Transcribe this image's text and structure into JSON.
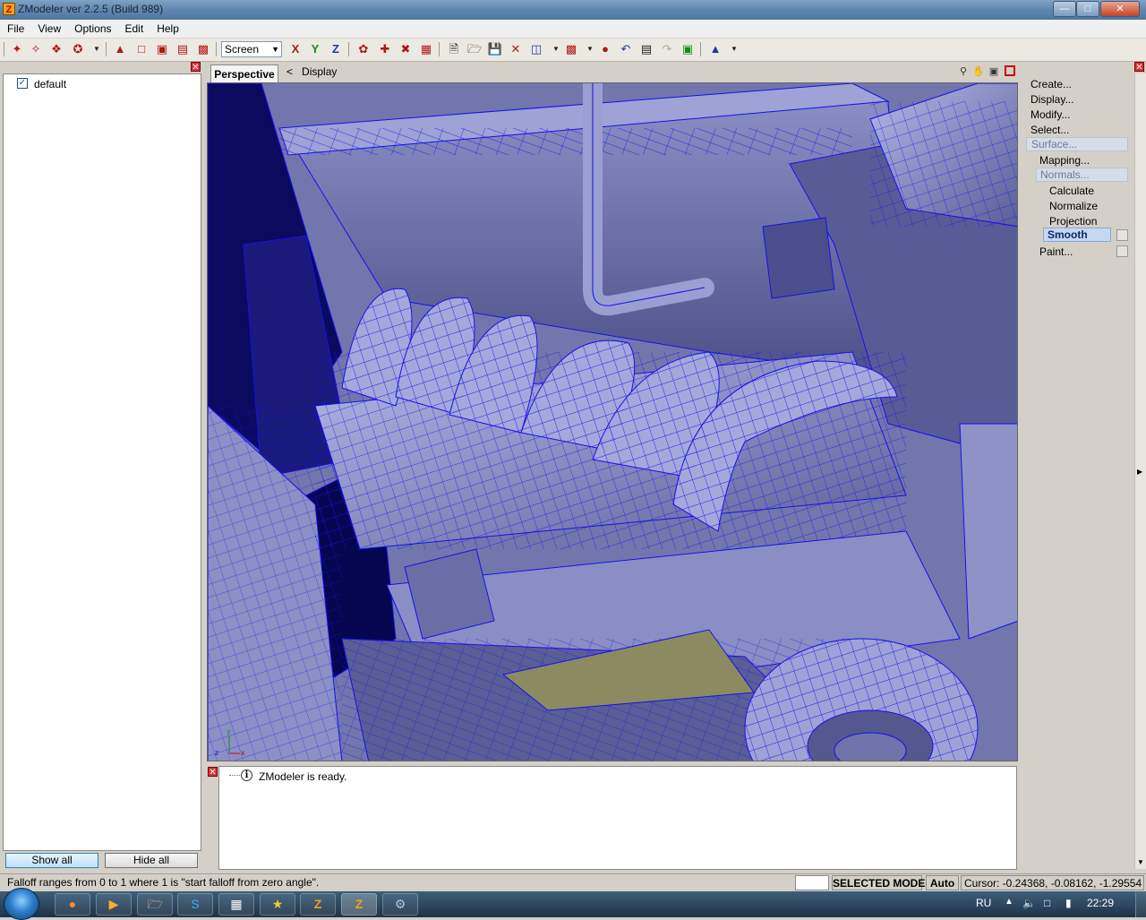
{
  "window": {
    "title": "ZModeler ver 2.2.5 (Build 989)",
    "min": "—",
    "max": "□",
    "close": "✕"
  },
  "menu": [
    "File",
    "View",
    "Options",
    "Edit",
    "Help"
  ],
  "toolbar": {
    "select_value": "Screen",
    "x_axis": "X",
    "y_axis": "Y",
    "z_axis": "Z"
  },
  "left_panel": {
    "tree_item": "default",
    "checked": true,
    "show_all": "Show all",
    "hide_all": "Hide all"
  },
  "viewport": {
    "tab_label": "Perspective",
    "breadcrumb_arrow": "<",
    "display_label": "Display",
    "axis_y": "y",
    "axis_z": "z",
    "axis_x": "x"
  },
  "right_panel": {
    "items": [
      "Create...",
      "Display...",
      "Modify...",
      "Select...",
      "Surface..."
    ],
    "surface_sub": [
      "Mapping...",
      "Normals..."
    ],
    "normals_sub": [
      "Calculate",
      "Normalize",
      "Projection",
      "Smooth"
    ],
    "paint": "Paint..."
  },
  "log": {
    "message": "ZModeler is ready."
  },
  "status": {
    "hint": "Falloff ranges from 0 to 1 where 1 is \"start falloff from zero angle\".",
    "mode": "SELECTED MODE",
    "auto": "Auto",
    "cursor": "Cursor: -0.24368, -0.08162, -1.29554"
  },
  "taskbar": {
    "lang": "RU",
    "time": "22:29"
  },
  "colors": {
    "wire": "#1010ee",
    "surface": "#6f74a8",
    "highlight": "#c5d8f2"
  }
}
